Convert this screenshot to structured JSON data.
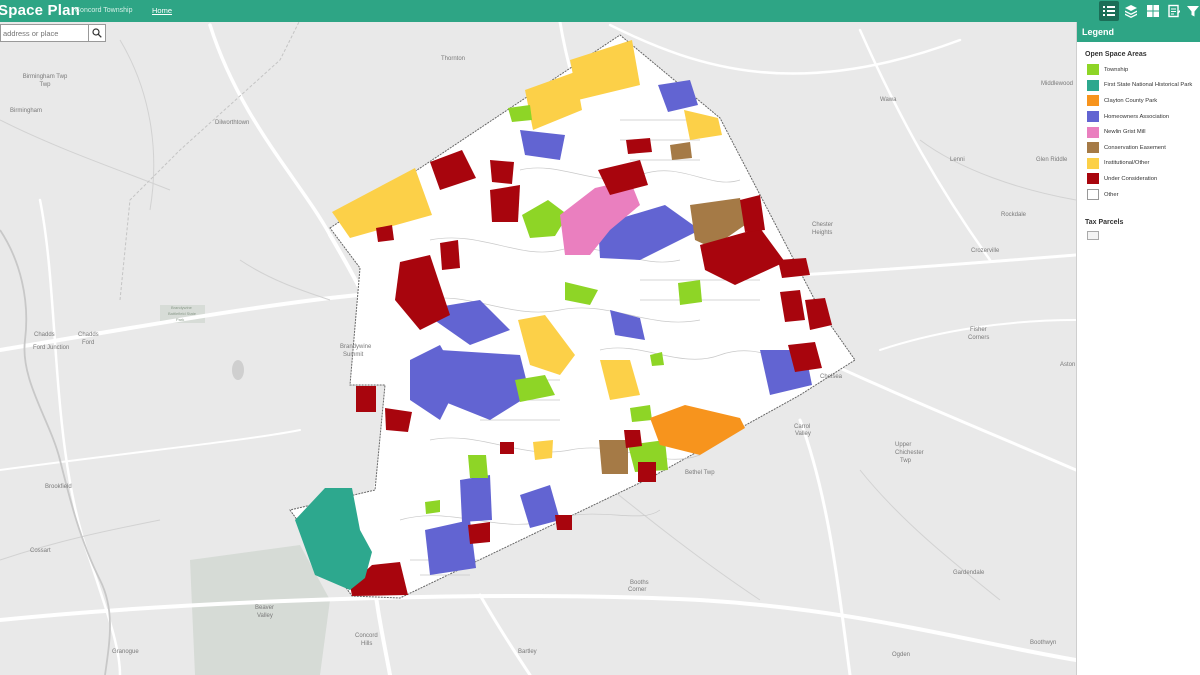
{
  "header": {
    "title": "Space Plan",
    "subtitle": "Concord Township",
    "home_link": "Home"
  },
  "toolbar": {
    "tools": [
      {
        "icon": "legend-list-icon",
        "active": true
      },
      {
        "icon": "layers-icon",
        "active": false
      },
      {
        "icon": "basemap-grid-icon",
        "active": false
      },
      {
        "icon": "print-icon",
        "active": false
      },
      {
        "icon": "filter-icon",
        "active": false
      }
    ]
  },
  "search": {
    "placeholder": "address or place",
    "icon": "search-icon"
  },
  "legend": {
    "title": "Legend",
    "section_title": "Open Space Areas",
    "items": [
      {
        "label": "Township",
        "color": "#8ed526"
      },
      {
        "label": "First State National Historical Park",
        "color": "#2da88e"
      },
      {
        "label": "Clayton County Park",
        "color": "#f7941d"
      },
      {
        "label": "Homeowners Association",
        "color": "#6264d2"
      },
      {
        "label": "Newlin Grist Mill",
        "color": "#ea7fbf"
      },
      {
        "label": "Conservation Easement",
        "color": "#a57a46"
      },
      {
        "label": "Institutional/Other",
        "color": "#fcd048"
      },
      {
        "label": "Under Consideration",
        "color": "#a8050d"
      },
      {
        "label": "Other",
        "color": "#ffffff"
      }
    ],
    "tax_parcels_title": "Tax Parcels"
  },
  "map_labels": [
    "Thornton",
    "Birmingham Twp",
    "Birmingham",
    "Dilworthtown",
    "Wawa",
    "Middlewood",
    "Lenni",
    "Glen Riddle",
    "Chester Heights",
    "Rockdale",
    "Crozerville",
    "Chadds Ford Junction",
    "Chadds Ford",
    "Brandywine Summit",
    "Fisher Corners",
    "Chelsea",
    "Carrol Valley",
    "Upper Chichester Twp",
    "Bethel Twp",
    "Brookfield",
    "Cossart",
    "Booths Corner",
    "Gardendale",
    "Beaver Valley",
    "Concord Hills",
    "Granogue",
    "Bartley",
    "Ogden",
    "Boothwyn",
    "Brandywine Battlefield State Park",
    "Aston"
  ]
}
